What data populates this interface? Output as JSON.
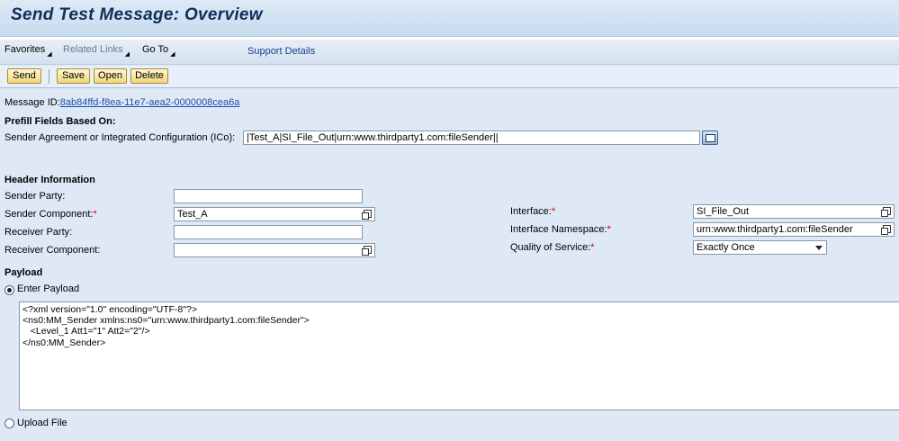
{
  "window": {
    "title": "Send Test Message: Overview"
  },
  "menu": {
    "favorites": "Favorites",
    "related_links": "Related Links",
    "go_to": "Go To",
    "support_details": "Support Details"
  },
  "toolbar": {
    "send": "Send",
    "save": "Save",
    "open": "Open",
    "delete": "Delete"
  },
  "message": {
    "id_label": "Message ID:",
    "id_value": "8ab84ffd-f8ea-11e7-aea2-0000008cea6a"
  },
  "prefill": {
    "heading": "Prefill Fields Based On:",
    "ico_label": "Sender Agreement or Integrated Configuration (ICo):",
    "ico_value": "|Test_A|SI_File_Out|urn:www.thirdparty1.com:fileSender||"
  },
  "header": {
    "heading": "Header Information",
    "sender_party_label": "Sender Party:",
    "sender_party_value": "",
    "sender_component_label": "Sender Component:",
    "sender_component_value": "Test_A",
    "receiver_party_label": "Receiver Party:",
    "receiver_party_value": "",
    "receiver_component_label": "Receiver Component:",
    "receiver_component_value": "",
    "interface_label": "Interface:",
    "interface_value": "SI_File_Out",
    "namespace_label": "Interface Namespace:",
    "namespace_value": "urn:www.thirdparty1.com:fileSender",
    "qos_label": "Quality of Service:",
    "qos_value": "Exactly Once",
    "required_marker": "*"
  },
  "payload": {
    "heading": "Payload",
    "enter_label": "Enter Payload",
    "upload_label": "Upload File",
    "selected_option": "Enter Payload",
    "content": "<?xml version=\"1.0\" encoding=\"UTF-8\"?>\n<ns0:MM_Sender xmlns:ns0=\"urn:www.thirdparty1.com:fileSender\">\n   <Level_1 Att1=\"1\" Att2=\"2\"/>\n</ns0:MM_Sender>"
  }
}
